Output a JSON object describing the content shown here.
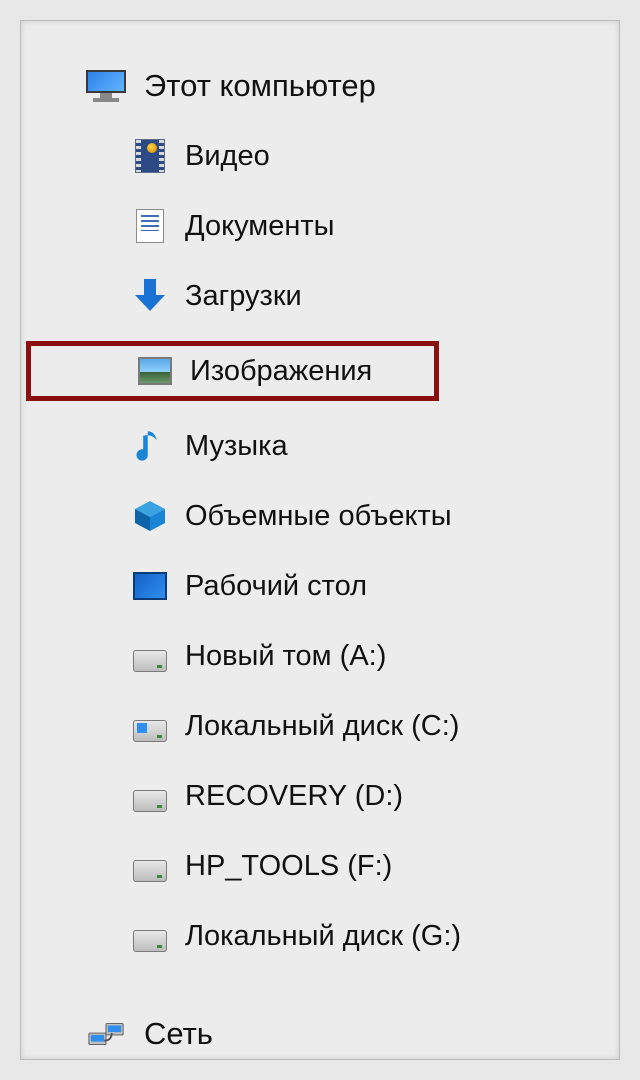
{
  "nav": {
    "this_pc": {
      "label": "Этот компьютер"
    },
    "children": [
      {
        "key": "videos",
        "label": "Видео"
      },
      {
        "key": "documents",
        "label": "Документы"
      },
      {
        "key": "downloads",
        "label": "Загрузки"
      },
      {
        "key": "pictures",
        "label": "Изображения",
        "highlighted": true
      },
      {
        "key": "music",
        "label": "Музыка"
      },
      {
        "key": "objects3d",
        "label": "Объемные объекты"
      },
      {
        "key": "desktop",
        "label": "Рабочий стол"
      },
      {
        "key": "drive_a",
        "label": "Новый том (A:)"
      },
      {
        "key": "drive_c",
        "label": "Локальный диск (C:)"
      },
      {
        "key": "drive_d",
        "label": "RECOVERY (D:)"
      },
      {
        "key": "drive_f",
        "label": "HP_TOOLS (F:)"
      },
      {
        "key": "drive_g",
        "label": "Локальный диск (G:)"
      }
    ],
    "network": {
      "label": "Сеть"
    }
  },
  "colors": {
    "highlight_border": "#8a0f0f",
    "accent_blue": "#1a72d4"
  }
}
